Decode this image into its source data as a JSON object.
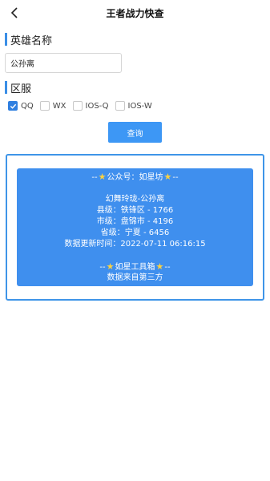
{
  "header": {
    "title": "王者战力快查",
    "back_icon": "chevron-left-icon"
  },
  "hero_section": {
    "label": "英雄名称",
    "input_value": "公孙离"
  },
  "server_section": {
    "label": "区服",
    "options": [
      {
        "label": "QQ",
        "checked": true
      },
      {
        "label": "WX",
        "checked": false
      },
      {
        "label": "IOS-Q",
        "checked": false
      },
      {
        "label": "IOS-W",
        "checked": false
      }
    ]
  },
  "query_button": {
    "label": "查询"
  },
  "result": {
    "header_prefix": "--",
    "header_text": "公众号：如星坊",
    "header_suffix": "--",
    "hero_line": "幻舞玲珑-公孙离",
    "county_line": "县级：铁锋区 - 1766",
    "city_line": "市级：盘锦市 - 4196",
    "province_line": "省级：宁夏 - 6456",
    "update_line": "数据更新时间：2022-07-11 06:16:15",
    "footer_prefix": "--",
    "footer_text": "如星工具箱",
    "footer_suffix": "--",
    "source_line": "数据来自第三方"
  },
  "colors": {
    "accent": "#3d97f5",
    "card": "#3f8fee",
    "star": "#ffd23f"
  }
}
